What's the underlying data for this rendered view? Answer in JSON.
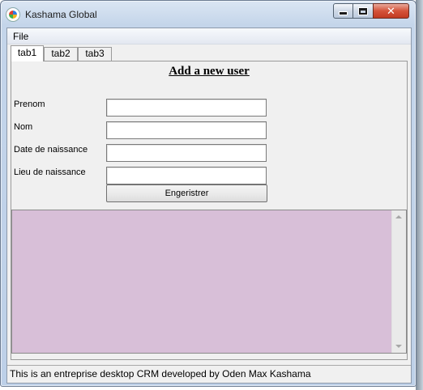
{
  "window": {
    "title": "Kashama Global",
    "close_glyph": "✕"
  },
  "menu": {
    "file": "File"
  },
  "tabs": [
    {
      "label": "tab1",
      "active": true
    },
    {
      "label": "tab2",
      "active": false
    },
    {
      "label": "tab3",
      "active": false
    }
  ],
  "form": {
    "title": "Add a new user",
    "fields": [
      {
        "label": "Prenom",
        "value": ""
      },
      {
        "label": "Nom",
        "value": ""
      },
      {
        "label": "Date de naissance",
        "value": ""
      },
      {
        "label": "Lieu de naissance",
        "value": ""
      }
    ],
    "submit_label": "Engeristrer"
  },
  "output_area": {
    "value": "",
    "background": "#d8bfd8"
  },
  "status": {
    "text": "This is an entreprise desktop CRM developed by Oden Max Kashama"
  }
}
